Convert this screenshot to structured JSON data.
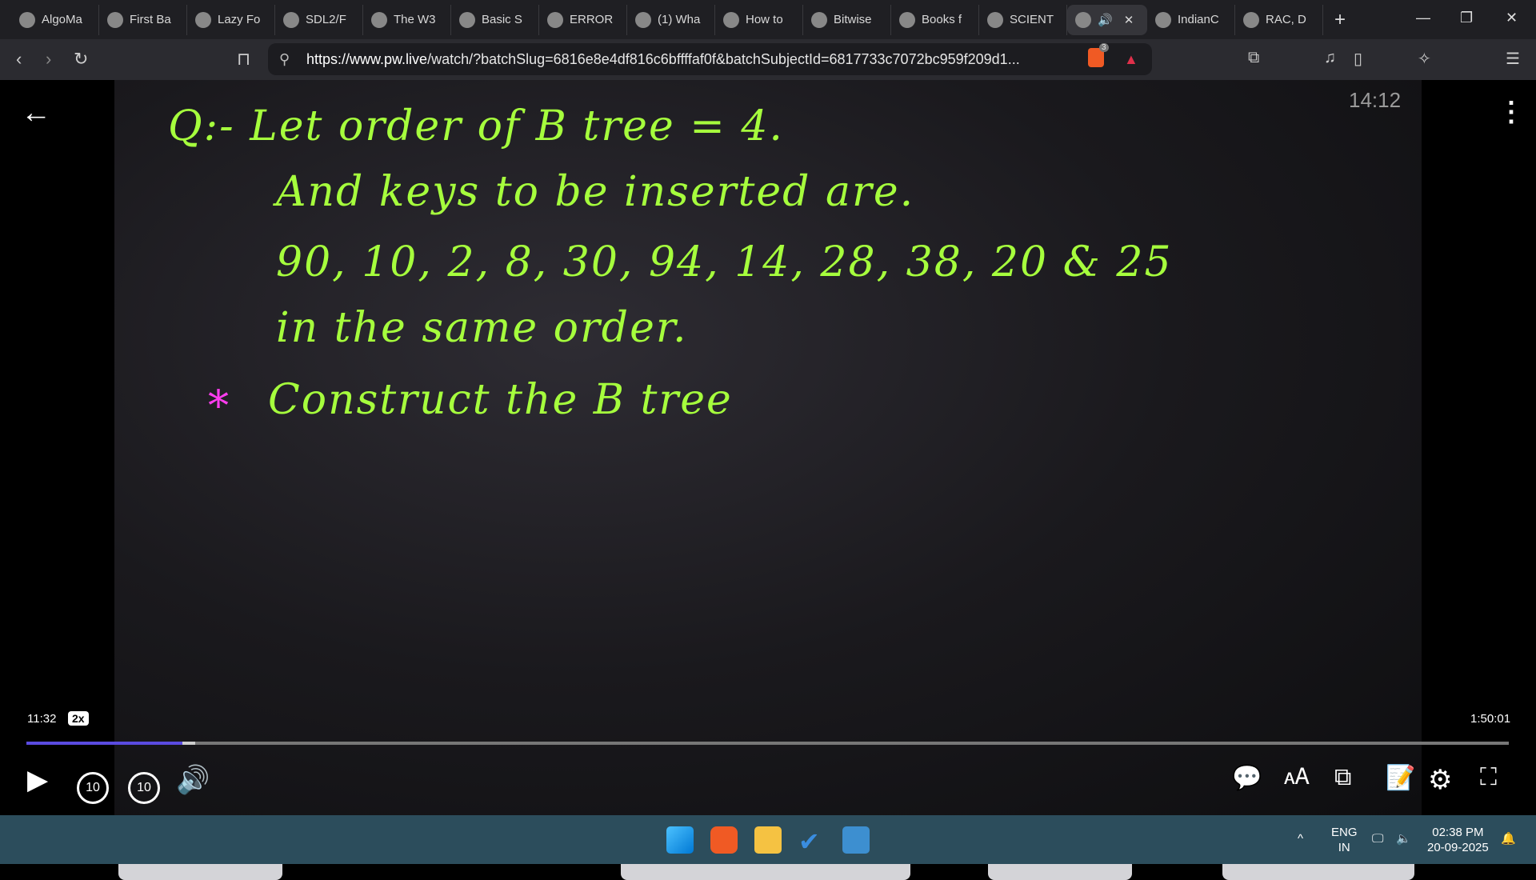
{
  "tabs": [
    {
      "label": "AlgoMa"
    },
    {
      "label": "First Ba"
    },
    {
      "label": "Lazy Fo"
    },
    {
      "label": "SDL2/F"
    },
    {
      "label": "The W3"
    },
    {
      "label": "Basic S"
    },
    {
      "label": "ERROR"
    },
    {
      "label": "(1) Wha"
    },
    {
      "label": "How to"
    },
    {
      "label": "Bitwise"
    },
    {
      "label": "Books f"
    },
    {
      "label": "SCIENT"
    },
    {
      "label": "🔊"
    },
    {
      "label": "IndianC"
    },
    {
      "label": "RAC, D"
    }
  ],
  "url_prefix": "https://www.pw.live",
  "url_rest": "/watch/?batchSlug=6816e8e4df816c6bffffaf0f&batchSubjectId=6817733c7072bc959f209d1...",
  "brave_badge": "3",
  "board": {
    "line1": "Q:- Let  order  of  B  tree = 4.",
    "line2": "And  keys  to  be  inserted  are.",
    "line3": "90,  10,  2,  8,  30,  94,  14,  28,  38,  20  &  25",
    "line4": "in  the  same  order.",
    "star": "*",
    "line5": "Construct  the  B  tree"
  },
  "player": {
    "stamp": "14:12",
    "current": "11:32",
    "speed": "2x",
    "duration": "1:50:01",
    "progress_percent": 10.5,
    "buffered_percent": 11.4,
    "rewind": "10",
    "forward": "10"
  },
  "taskbar": {
    "lang1": "ENG",
    "lang2": "IN",
    "time": "02:38 PM",
    "date": "20-09-2025"
  }
}
